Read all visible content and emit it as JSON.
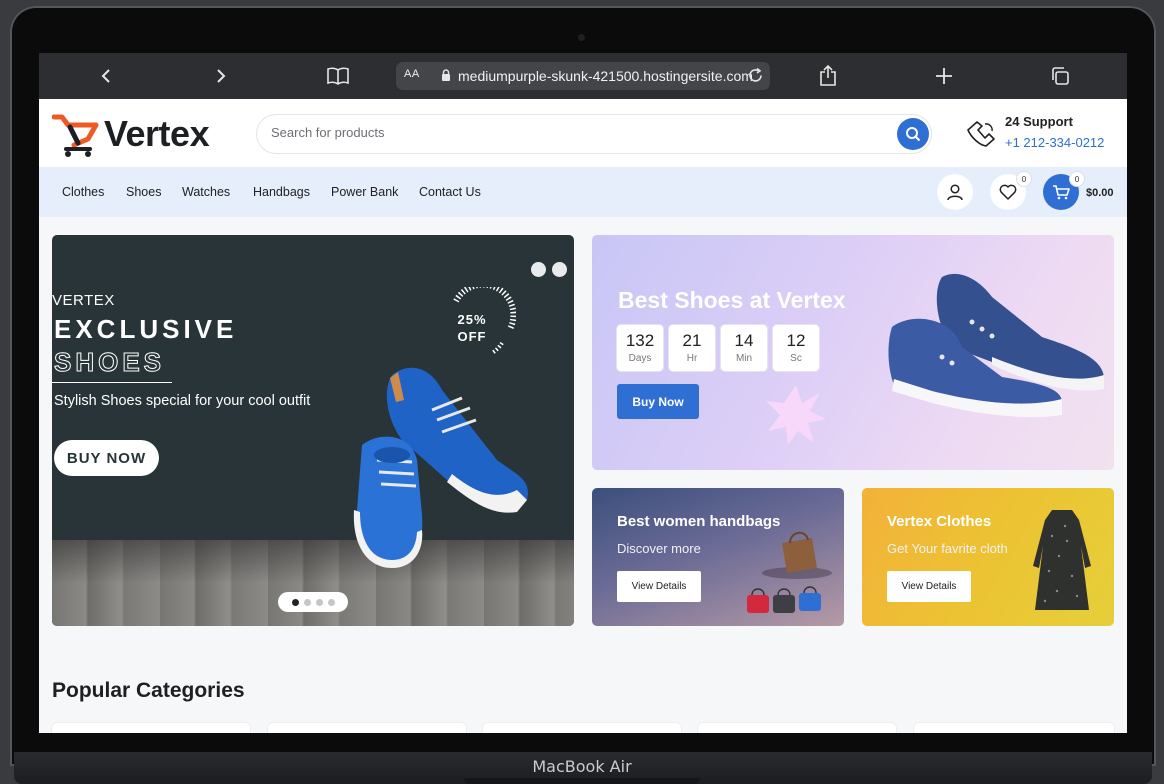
{
  "device": {
    "model": "MacBook Air"
  },
  "browser": {
    "url_aa": "AA",
    "url": "mediumpurple-skunk-421500.hostingersite.com"
  },
  "header": {
    "logo_text": "Vertex",
    "search_placeholder": "Search for products",
    "support_title": "24 Support",
    "support_phone": "+1 212-334-0212"
  },
  "nav": {
    "items": [
      "Clothes",
      "Shoes",
      "Watches",
      "Handbags",
      "Power Bank",
      "Contact Us"
    ],
    "wishlist_count": "0",
    "cart_count": "0",
    "cart_total": "$0.00"
  },
  "hero": {
    "brand": "VERTEX",
    "title_line1": "EXCLUSIVE",
    "title_line2": "SHOES",
    "subtitle": "Stylish Shoes  special for your cool outfit",
    "cta": "BUY NOW",
    "discount_line1": "25%",
    "discount_line2": "OFF",
    "slide_count": 4,
    "active_slide": 1
  },
  "promo": {
    "title": "Best Shoes at Vertex",
    "countdown": [
      {
        "value": "132",
        "label": "Days"
      },
      {
        "value": "21",
        "label": "Hr"
      },
      {
        "value": "14",
        "label": "Min"
      },
      {
        "value": "12",
        "label": "Sc"
      }
    ],
    "cta": "Buy Now"
  },
  "cards": {
    "bags": {
      "title": "Best women handbags",
      "subtitle": "Discover more",
      "cta": "View Details"
    },
    "clothes": {
      "title": "Vertex Clothes",
      "subtitle": "Get Your favrite cloth",
      "cta": "View Details"
    }
  },
  "sections": {
    "popular_title": "Popular Categories"
  },
  "colors": {
    "accent": "#2f6ed3",
    "logo_orange": "#ef5a24",
    "hero_bg": "#283438"
  },
  "icons": [
    "back-icon",
    "forward-icon",
    "bookmarks-icon",
    "lock-icon",
    "reload-icon",
    "share-icon",
    "new-tab-icon",
    "tabs-icon",
    "search-icon",
    "support-icon",
    "user-icon",
    "heart-icon",
    "cart-icon"
  ]
}
